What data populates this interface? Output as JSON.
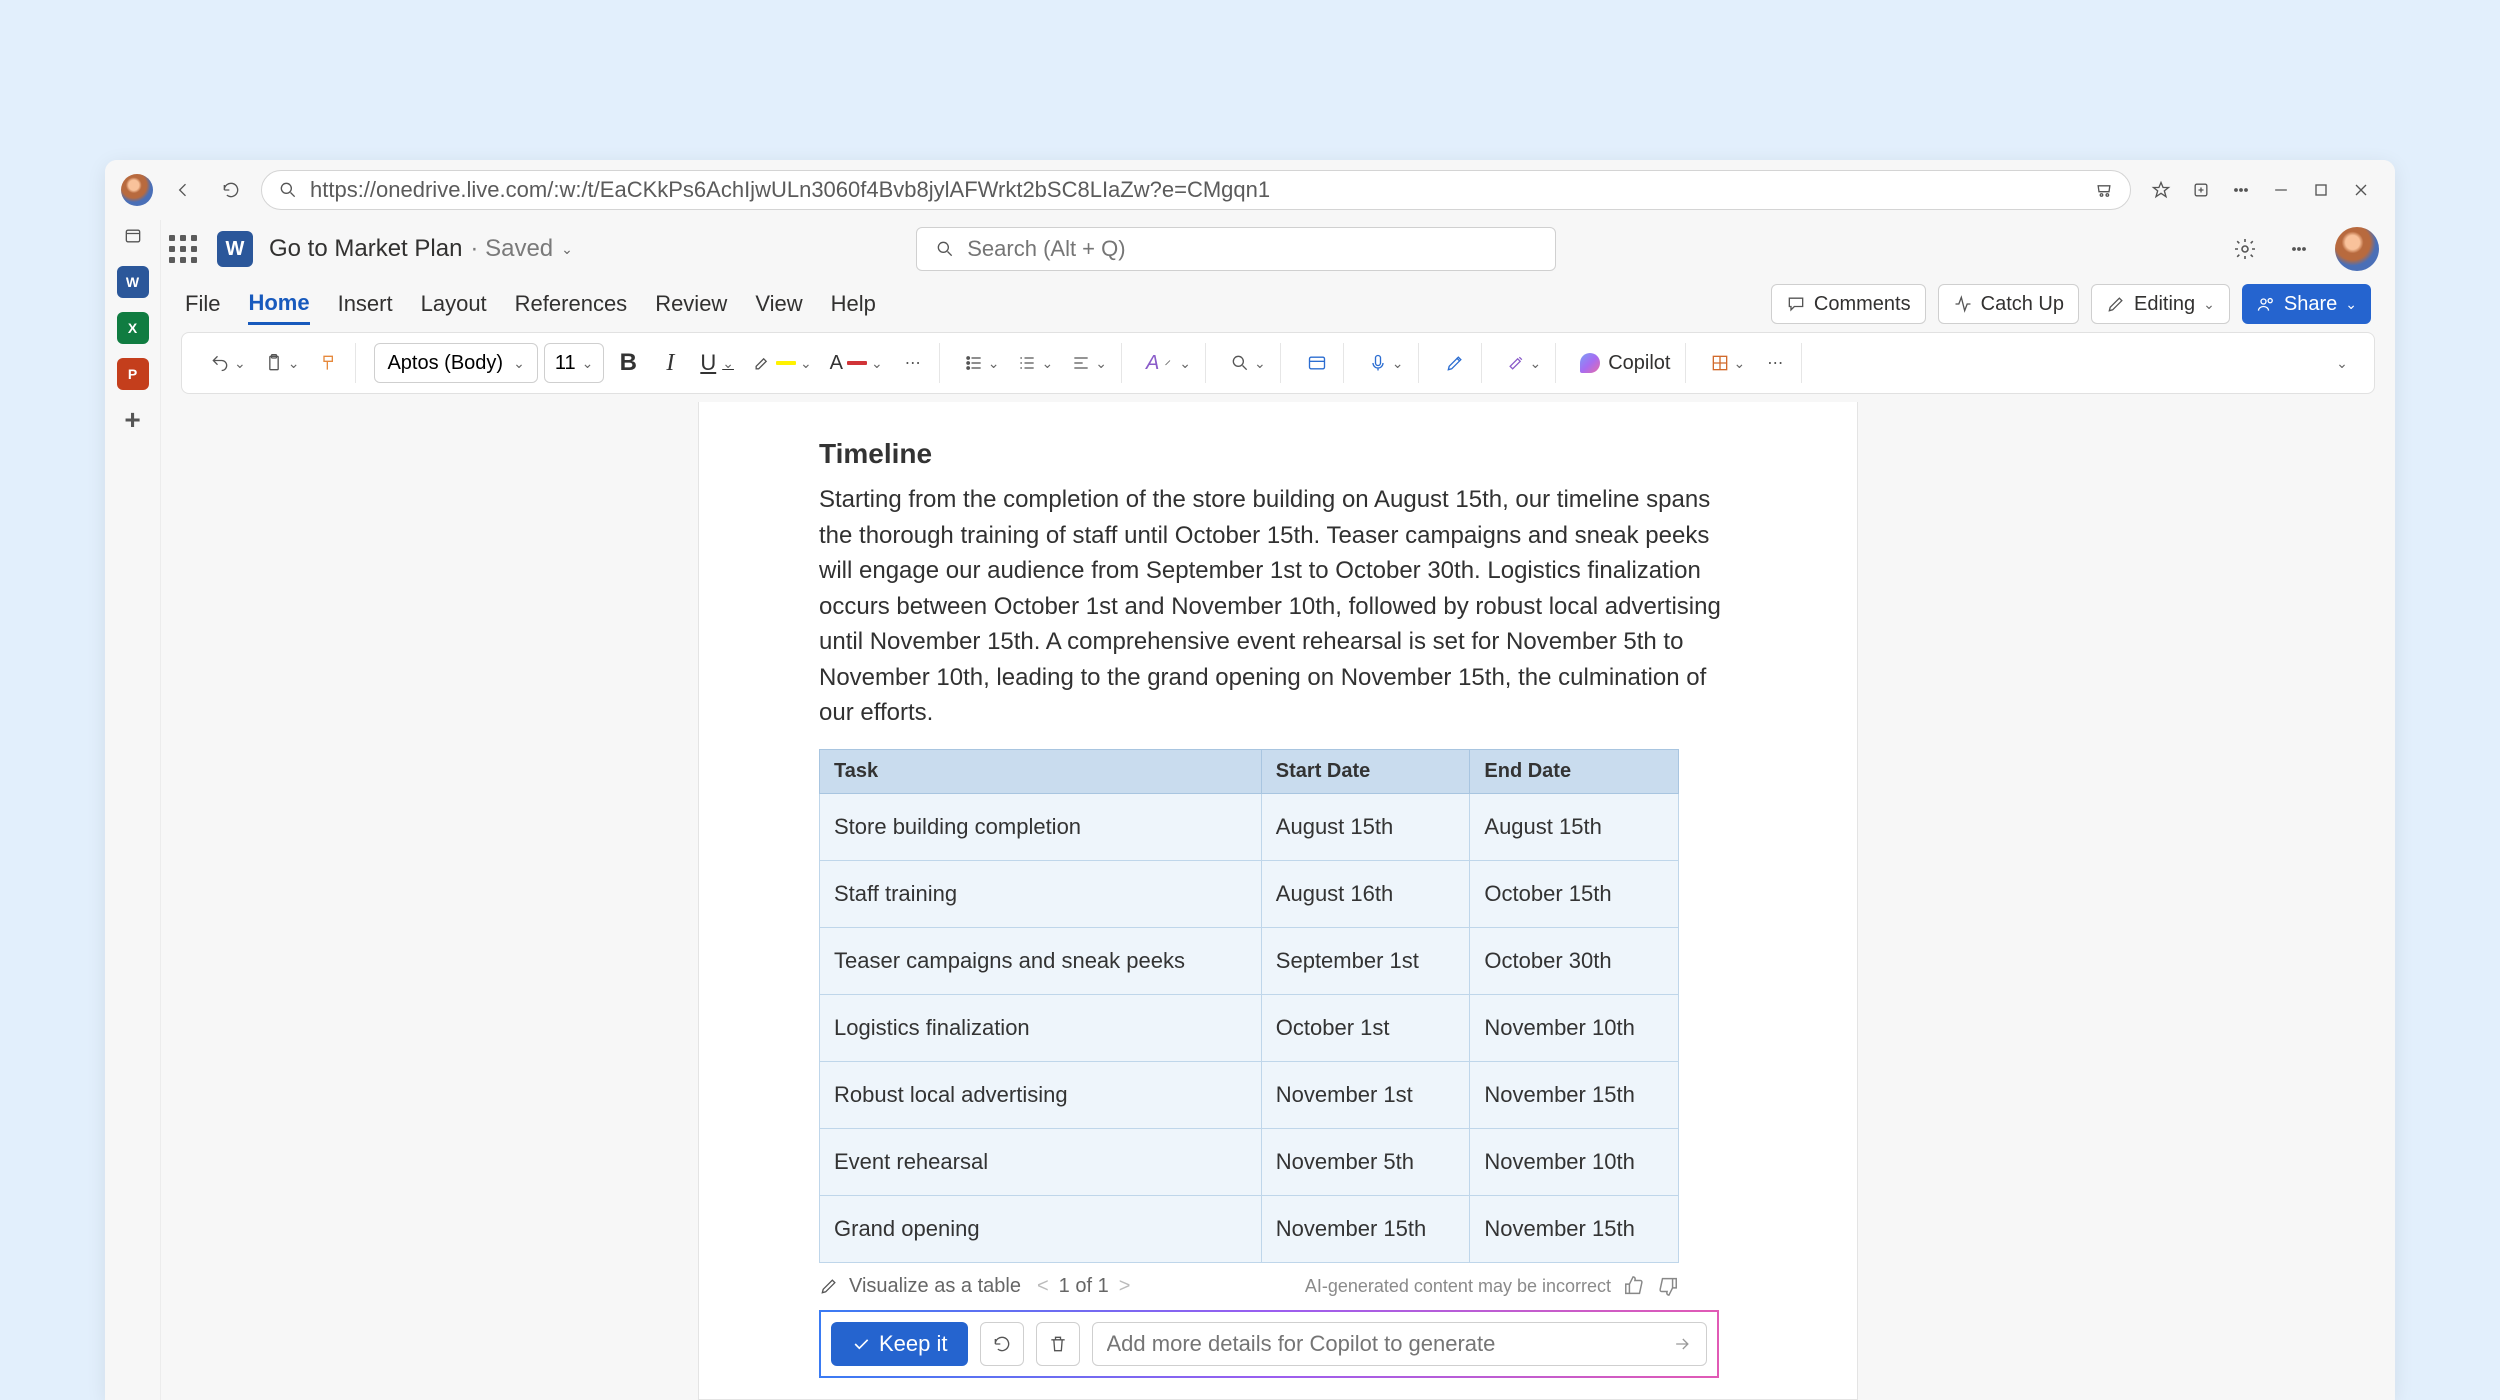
{
  "browser": {
    "url": "https://onedrive.live.com/:w:/t/EaCKkPs6AchIjwULn3060f4Bvb8jylAFWrkt2bSC8LIaZw?e=CMgqn1"
  },
  "header": {
    "doc_title": "Go to Market Plan",
    "saved_label": "· Saved",
    "search_placeholder": "Search (Alt + Q)"
  },
  "tabs": {
    "items": [
      "File",
      "Home",
      "Insert",
      "Layout",
      "References",
      "Review",
      "View",
      "Help"
    ],
    "active_index": 1,
    "comments": "Comments",
    "catch_up": "Catch Up",
    "editing": "Editing",
    "share": "Share"
  },
  "ribbon": {
    "font_name": "Aptos (Body)",
    "font_size": "11",
    "copilot": "Copilot"
  },
  "document": {
    "heading": "Timeline",
    "paragraph": "Starting from the completion of the store building on August 15th, our timeline spans the thorough training of staff until October 15th. Teaser campaigns and sneak peeks will engage our audience from September 1st to October 30th. Logistics finalization occurs between October 1st and November 10th, followed by robust local advertising until November 15th. A comprehensive event rehearsal is set for November 5th to November 10th, leading to the grand opening on November 15th, the culmination of our efforts.",
    "table": {
      "headers": [
        "Task",
        "Start Date",
        "End Date"
      ],
      "rows": [
        [
          "Store building completion",
          "August 15th",
          "August 15th"
        ],
        [
          "Staff training",
          "August 16th",
          "October 15th"
        ],
        [
          "Teaser campaigns and sneak peeks",
          "September 1st",
          "October 30th"
        ],
        [
          "Logistics finalization",
          "October 1st",
          "November 10th"
        ],
        [
          "Robust local advertising",
          "November 1st",
          "November 15th"
        ],
        [
          "Event rehearsal",
          "November 5th",
          "November 10th"
        ],
        [
          "Grand opening",
          "November 15th",
          "November 15th"
        ]
      ]
    }
  },
  "copilot_panel": {
    "visualize": "Visualize as a table",
    "pager": "1 of 1",
    "disclaimer": "AI-generated content may be incorrect",
    "keep": "Keep it",
    "input_placeholder": "Add more details for Copilot to generate"
  },
  "colors": {
    "accent": "#2564cf",
    "word": "#2b579a",
    "excel": "#107c41",
    "ppt": "#c43e1c"
  }
}
